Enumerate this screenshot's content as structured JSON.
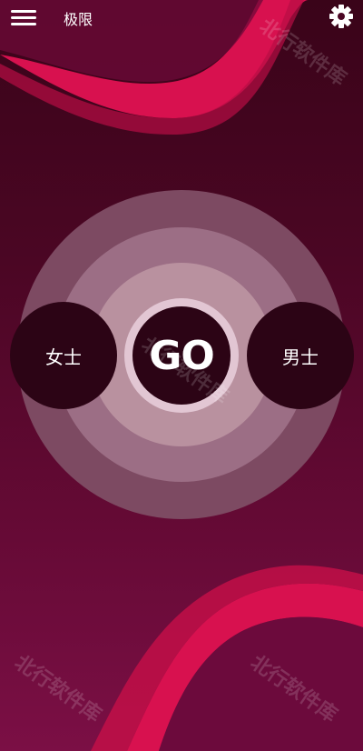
{
  "header": {
    "title": "极限",
    "menu_icon": "hamburger-menu-icon",
    "settings_icon": "gear-icon"
  },
  "main": {
    "left_label": "女士",
    "center_label": "GO",
    "right_label": "男士"
  },
  "watermark": "北行软件库",
  "colors": {
    "background_dark": "#3a0419",
    "background_light": "#7b0f45",
    "wave_accent": "#d8114f",
    "button_dark": "#2c0415",
    "ring_light": "#e2c6d3"
  }
}
